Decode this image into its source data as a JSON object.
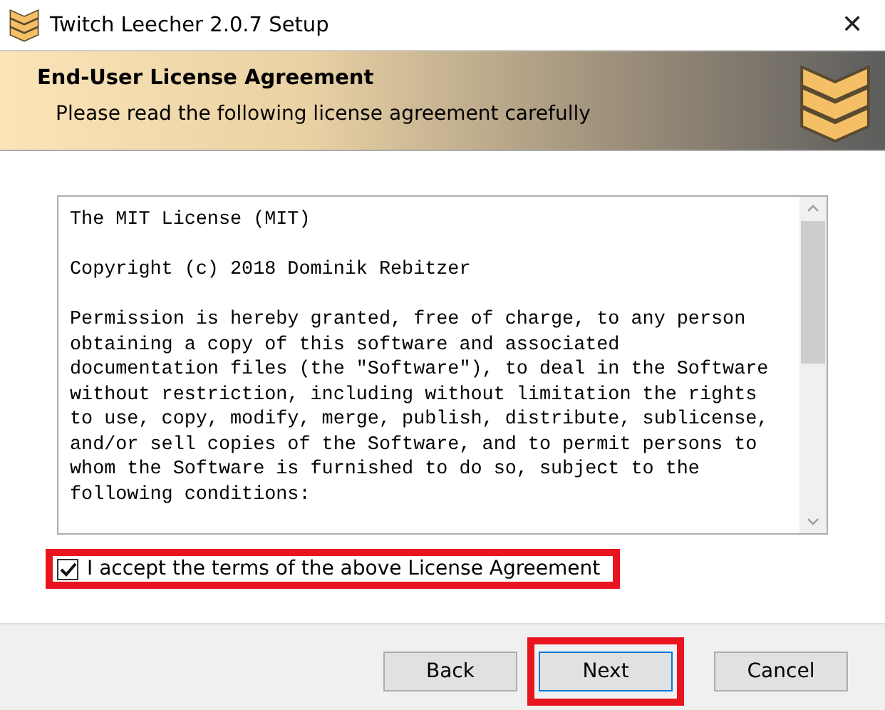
{
  "window": {
    "title": "Twitch Leecher 2.0.7 Setup",
    "close": "✕"
  },
  "header": {
    "title": "End-User License Agreement",
    "subtitle": "Please read the following license agreement carefully"
  },
  "license": {
    "paragraphs": [
      [
        "The MIT License (MIT)"
      ],
      [
        "Copyright (c) 2018 Dominik Rebitzer"
      ],
      [
        "Permission is hereby granted, free of charge, to any person",
        "obtaining a copy of this software and associated",
        "documentation files (the \"Software\"), to deal in the Software",
        "without restriction, including without limitation the rights",
        "to use, copy, modify, merge, publish, distribute, sublicense,",
        "and/or sell copies of the Software, and to permit persons to",
        "whom the Software is furnished to do so, subject to the",
        "following conditions:"
      ]
    ]
  },
  "accept": {
    "label": "I accept the terms of the above License Agreement",
    "checked": true,
    "highlighted": true
  },
  "buttons": [
    {
      "label": "Back",
      "focused": false,
      "highlighted": false
    },
    {
      "label": "Next",
      "focused": true,
      "highlighted": true
    },
    {
      "label": "Cancel",
      "focused": false,
      "highlighted": false
    }
  ]
}
